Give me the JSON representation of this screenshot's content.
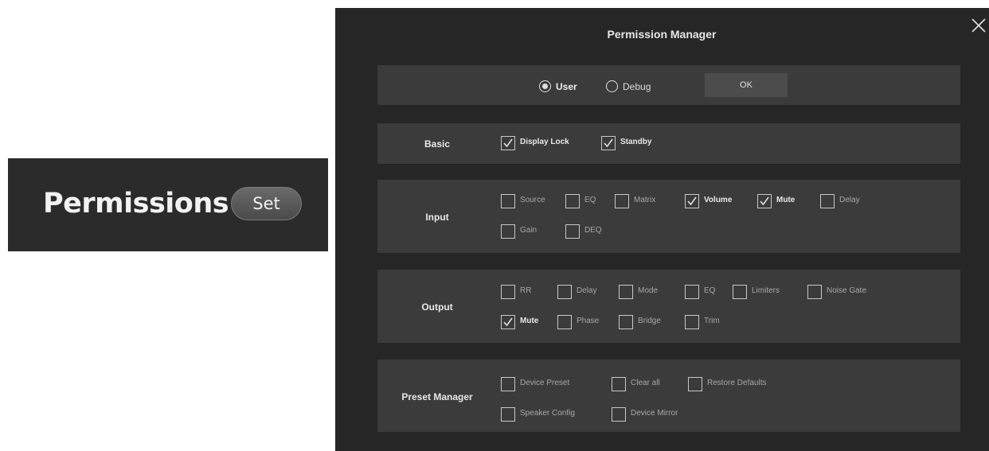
{
  "left_panel": {
    "title": "Permissions",
    "set_label": "Set"
  },
  "dialog": {
    "title": "Permission Manager",
    "close_icon": "close-icon",
    "mode": {
      "user_label": "User",
      "debug_label": "Debug",
      "selected": "User",
      "ok_label": "OK"
    },
    "sections": {
      "basic": {
        "label": "Basic",
        "items": [
          {
            "label": "Display Lock",
            "checked": true
          },
          {
            "label": "Standby",
            "checked": true
          }
        ]
      },
      "input": {
        "label": "Input",
        "items": [
          {
            "label": "Source",
            "checked": false
          },
          {
            "label": "EQ",
            "checked": false
          },
          {
            "label": "Matrix",
            "checked": false
          },
          {
            "label": "Volume",
            "checked": true
          },
          {
            "label": "Mute",
            "checked": true
          },
          {
            "label": "Delay",
            "checked": false
          },
          {
            "label": "Gain",
            "checked": false
          },
          {
            "label": "DEQ",
            "checked": false
          }
        ]
      },
      "output": {
        "label": "Output",
        "items": [
          {
            "label": "RR",
            "checked": false
          },
          {
            "label": "Delay",
            "checked": false
          },
          {
            "label": "Mode",
            "checked": false
          },
          {
            "label": "EQ",
            "checked": false
          },
          {
            "label": "Limiters",
            "checked": false
          },
          {
            "label": "Noise Gate",
            "checked": false
          },
          {
            "label": "Mute",
            "checked": true
          },
          {
            "label": "Phase",
            "checked": false
          },
          {
            "label": "Bridge",
            "checked": false
          },
          {
            "label": "Trim",
            "checked": false
          }
        ]
      },
      "preset": {
        "label": "Preset Manager",
        "items": [
          {
            "label": "Device Preset",
            "checked": false
          },
          {
            "label": "Clear all",
            "checked": false
          },
          {
            "label": "Restore Defaults",
            "checked": false
          },
          {
            "label": "Speaker Config",
            "checked": false
          },
          {
            "label": "Device Mirror",
            "checked": false
          }
        ]
      }
    }
  },
  "colors": {
    "panel_bg": "#2b2b2b",
    "dialog_bg": "#262626",
    "section_bg": "#3b3b3b",
    "text_primary": "#e8e8e8",
    "text_secondary": "#a8a8a8"
  }
}
